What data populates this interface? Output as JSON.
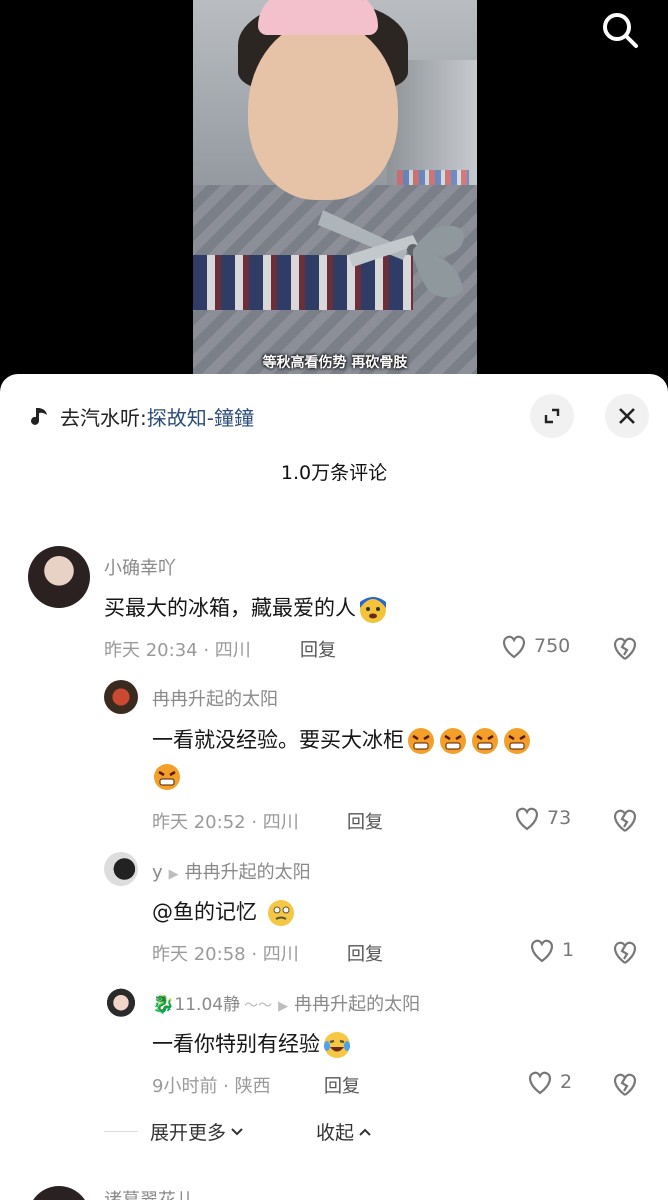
{
  "video": {
    "subtitle": "等秋高看伤势 再砍骨肢"
  },
  "icons": {
    "search": "search-icon",
    "music": "music-note-icon",
    "expand": "expand-icon",
    "close": "close-icon",
    "heart": "heart-icon",
    "dislike": "broken-heart-icon"
  },
  "sheet": {
    "music_prefix": "去汽水听:",
    "music_name": "探故知-鐘鐘",
    "comment_count": "1.0万条评论"
  },
  "comments": [
    {
      "username": "小确幸吖",
      "text": "买最大的冰箱，藏最爱的人",
      "meta": "昨天 20:34 · 四川",
      "reply": "回复",
      "likes": "750"
    },
    {
      "username": "冉冉升起的太阳",
      "text": "一看就没经验。要买大冰柜",
      "meta": "昨天 20:52 · 四川",
      "reply": "回复",
      "likes": "73"
    },
    {
      "username": "y",
      "reply_to": "冉冉升起的太阳",
      "text": "@鱼的记忆",
      "meta": "昨天 20:58 · 四川",
      "reply": "回复",
      "likes": "1"
    },
    {
      "username": "11.04静",
      "reply_to": "冉冉升起的太阳",
      "text": "一看你特别有经验",
      "meta": "9小时前 · 陕西",
      "reply": "回复",
      "likes": "2"
    }
  ],
  "actions": {
    "expand_more": "展开更多",
    "collapse": "收起"
  },
  "next_comment": {
    "username": "诸葛翠花儿"
  },
  "colors": {
    "accent_link": "#2c4d7a",
    "meta_gray": "#9a9a9a"
  }
}
